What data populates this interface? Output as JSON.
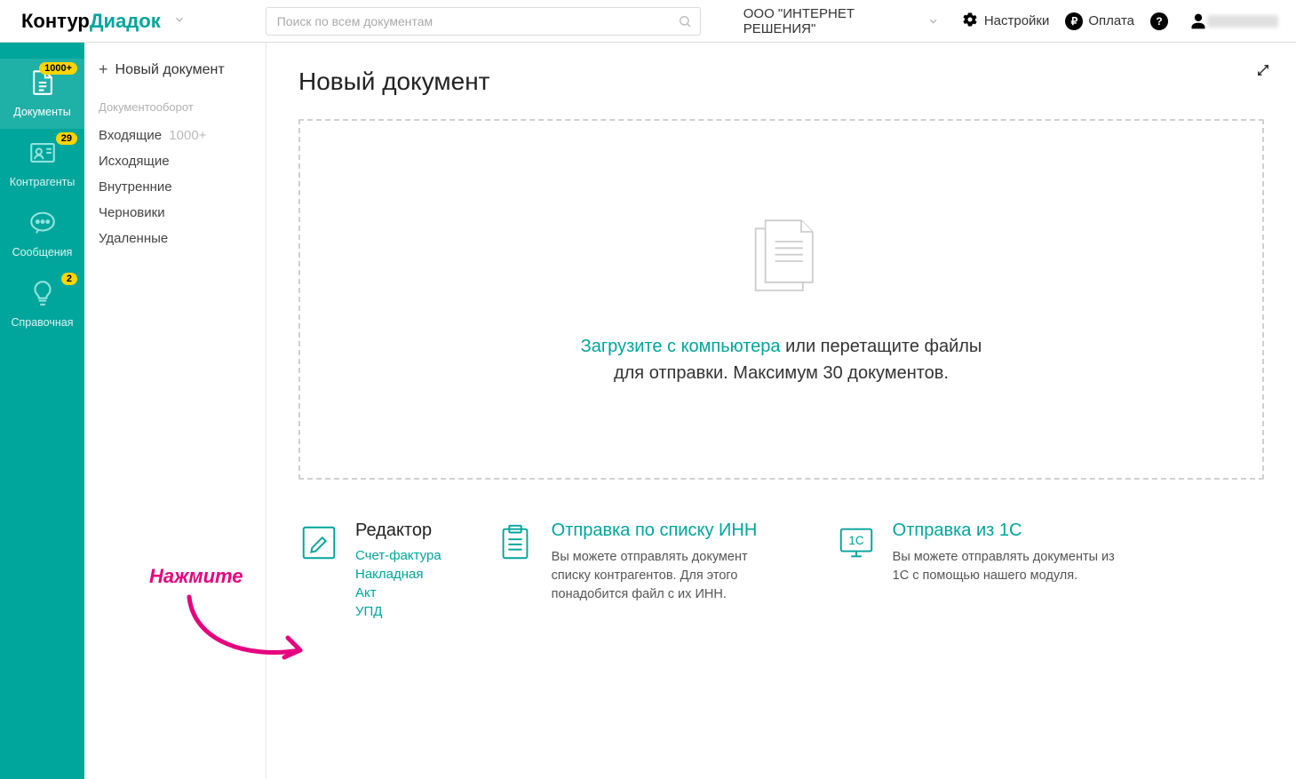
{
  "header": {
    "logo1": "Контур",
    "logo2": "Диадок",
    "search_placeholder": "Поиск по всем документам",
    "org_name": "ООО \"ИНТЕРНЕТ РЕШЕНИЯ\"",
    "settings_label": "Настройки",
    "payment_label": "Оплата"
  },
  "rail": {
    "documents_label": "Документы",
    "documents_badge": "1000+",
    "contractors_label": "Контрагенты",
    "contractors_badge": "29",
    "messages_label": "Сообщения",
    "help_label": "Справочная",
    "help_badge": "2"
  },
  "subnav": {
    "new_doc": "Новый документ",
    "section": "Документооборот",
    "inbox_label": "Входящие",
    "inbox_count": "1000+",
    "outbox_label": "Исходящие",
    "internal_label": "Внутренние",
    "drafts_label": "Черновики",
    "deleted_label": "Удаленные"
  },
  "main": {
    "title": "Новый документ",
    "drop_link": "Загрузите с компьютера",
    "drop_rest": " или перетащите файлы",
    "drop_line2": "для отправки. Максимум 30 документов."
  },
  "cards": {
    "editor_title": "Редактор",
    "editor_links": {
      "invoice": "Счет-фактура",
      "waybill": "Накладная",
      "act": "Акт",
      "upd": "УПД"
    },
    "inn_title": "Отправка по списку ИНН",
    "inn_desc": "Вы можете отправлять документ списку контрагентов. Для этого понадобится файл с их ИНН.",
    "onec_title": "Отправка из 1С",
    "onec_desc": "Вы можете отправлять документы из 1С с помощью нашего модуля.",
    "onec_icon_text": "1С"
  },
  "annotation": {
    "text": "Нажмите"
  }
}
